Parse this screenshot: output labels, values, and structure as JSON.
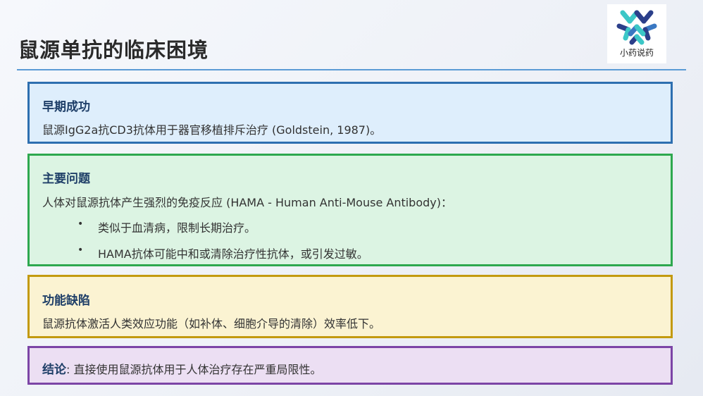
{
  "slide": {
    "title": "鼠源单抗的临床困境"
  },
  "logo": {
    "text": "小药说药",
    "colors": {
      "teal": "#3cc7c7",
      "navy": "#2b3f8a",
      "blue": "#3a78c2"
    }
  },
  "cards": {
    "early_success": {
      "heading": "早期成功",
      "body": "鼠源IgG2a抗CD3抗体用于器官移植排斥治疗 (Goldstein, 1987)。",
      "border_color": "#2e6fb0"
    },
    "main_problem": {
      "heading": "主要问题",
      "body": "人体对鼠源抗体产生强烈的免疫反应 (HAMA - Human Anti-Mouse Antibody)：",
      "bullets": [
        "类似于血清病，限制长期治疗。",
        "HAMA抗体可能中和或清除治疗性抗体，或引发过敏。"
      ],
      "bullet_symbol": "•",
      "border_color": "#2ea84f"
    },
    "functional_defect": {
      "heading": "功能缺陷",
      "body": "鼠源抗体激活人类效应功能（如补体、细胞介导的清除）效率低下。",
      "border_color": "#c39a10"
    },
    "conclusion": {
      "label": "结论",
      "separator": ": ",
      "body": "直接使用鼠源抗体用于人体治疗存在严重局限性。",
      "border_color": "#7c45a6"
    }
  }
}
